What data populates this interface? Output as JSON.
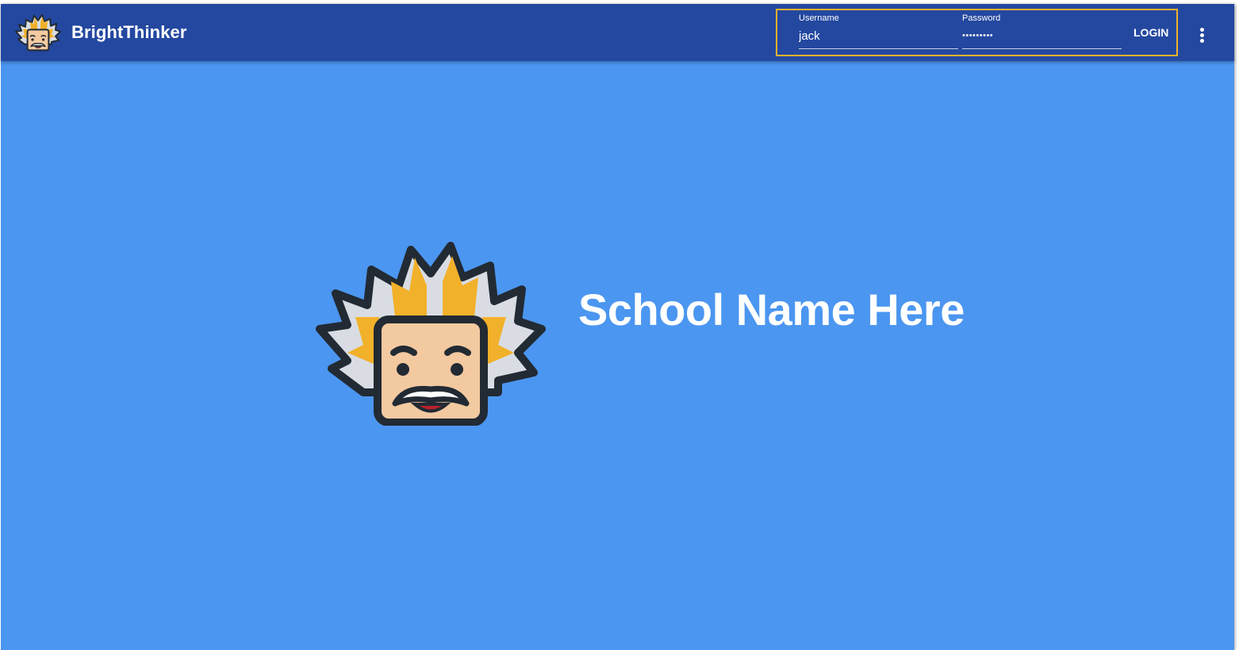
{
  "app": {
    "name": "BrightThinker",
    "logo_icon": "einstein-mascot-icon"
  },
  "login": {
    "username_label": "Username",
    "username_value": "jack",
    "password_label": "Password",
    "password_value": "•••••••••",
    "login_label": "LOGIN",
    "more_icon": "more-vertical-icon"
  },
  "hero": {
    "school_name": "School Name Here",
    "mascot_icon": "einstein-mascot-icon"
  },
  "colors": {
    "appbar": "#2448a0",
    "background": "#4b96f0",
    "focus_outline": "#f2b12a",
    "hair_yellow": "#f2b12a",
    "hair_grey": "#d9dde3",
    "skin": "#f3c9a0",
    "outline": "#222a33"
  }
}
